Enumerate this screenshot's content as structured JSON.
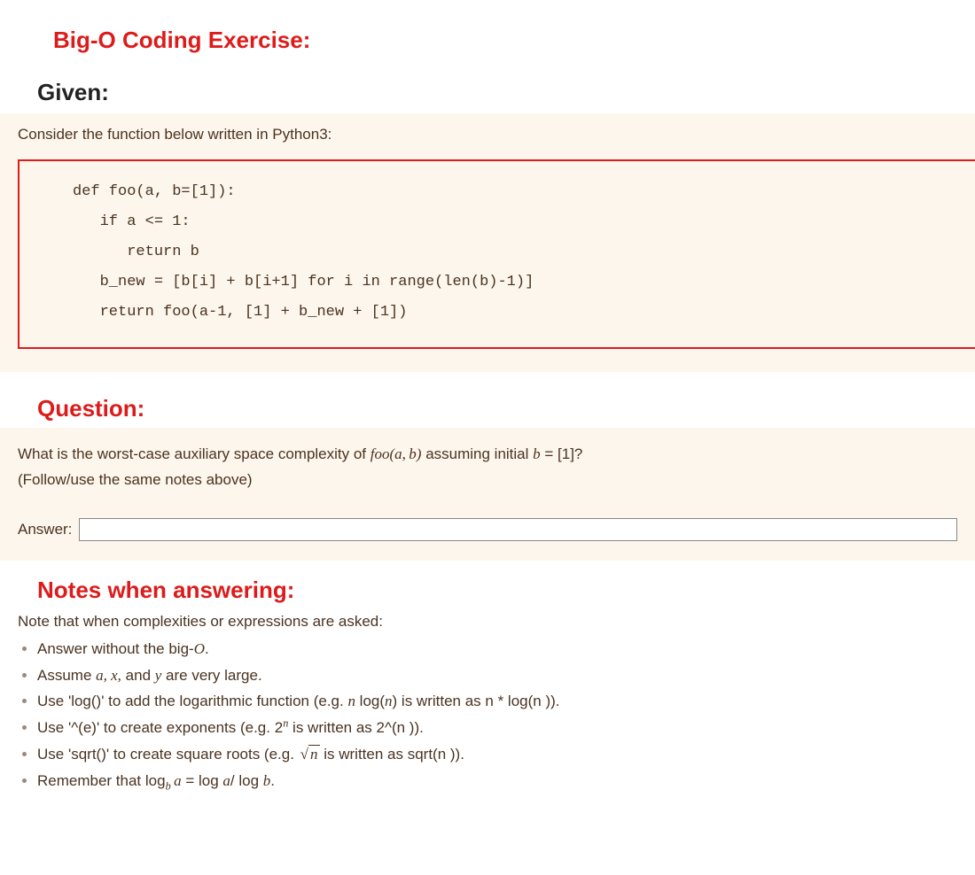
{
  "title": "Big-O Coding Exercise:",
  "given": {
    "heading": "Given:",
    "intro": "Consider the function below written in Python3:",
    "code": "def foo(a, b=[1]):\n   if a <= 1:\n      return b\n   b_new = [b[i] + b[i+1] for i in range(len(b)-1)]\n   return foo(a-1, [1] + b_new + [1])"
  },
  "question": {
    "heading": "Question:",
    "prefix": "What is the worst-case auxiliary space complexity of ",
    "func": "foo(a, b)",
    "mid": " assuming initial ",
    "cond_var": "b",
    "cond_eq": " = ",
    "cond_val": "[1]",
    "suffix": "?",
    "follow": "(Follow/use the same notes above)",
    "answer_label": "Answer:",
    "answer_value": ""
  },
  "notes": {
    "heading": "Notes when answering:",
    "intro": "Note that when complexities or expressions are asked:",
    "items": {
      "one_a": "Answer without the big-",
      "one_b": "O",
      "one_c": ".",
      "two_a": "Assume ",
      "two_vars": "a, x,",
      "two_mid": " and ",
      "two_var_y": "y",
      "two_b": " are very large.",
      "three_a": "Use 'log()' to add the logarithmic function (e.g. ",
      "three_expr_n": "n",
      "three_expr_log": " log(",
      "three_expr_n2": "n",
      "three_expr_close": ")",
      "three_b": " is written as n * log(n )).",
      "four_a": "Use '^(e)' to create exponents (e.g. ",
      "four_base": "2",
      "four_sup": "n",
      "four_b": " is written as 2^(n )).",
      "five_a": "Use 'sqrt()' to create square roots (e.g. ",
      "five_sqrt_arg": "n",
      "five_b": " is written as sqrt(n )).",
      "six_a": "Remember that ",
      "six_log": "log",
      "six_sub": "b",
      "six_sp": " ",
      "six_a_var": "a",
      "six_eq": " = ",
      "six_log2": " log ",
      "six_a_var2": "a",
      "six_slash": "/",
      "six_log3": " log ",
      "six_b_var": "b",
      "six_end": "."
    }
  }
}
